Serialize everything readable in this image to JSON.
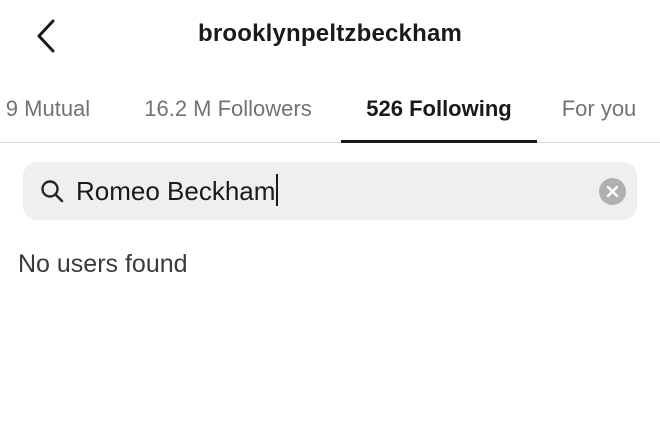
{
  "header": {
    "title": "brooklynpeltzbeckham",
    "back_icon": "chevron-left-icon"
  },
  "tabs": [
    {
      "label": "9 Mutual",
      "active": false
    },
    {
      "label": "16.2 M Followers",
      "active": false
    },
    {
      "label": "526 Following",
      "active": true
    },
    {
      "label": "For you",
      "active": false
    }
  ],
  "search": {
    "value": "Romeo Beckham",
    "search_icon": "search-icon",
    "clear_icon": "clear-icon"
  },
  "results": {
    "empty_message": "No users found"
  },
  "colors": {
    "active_tab": "#1a1a1a",
    "inactive_tab": "#737373",
    "search_background": "#efefef",
    "clear_button": "#b0b0b0"
  }
}
